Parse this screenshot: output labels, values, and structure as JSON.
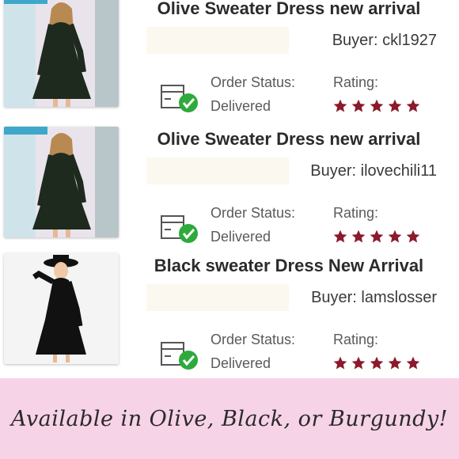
{
  "orders": [
    {
      "title": "Olive Sweater Dress new arrival",
      "buyer": "Buyer: ckl1927",
      "status_label": "Order Status:",
      "status_value": "Delivered",
      "rating_label": "Rating:",
      "rating": 5,
      "dress_color": "#1f2a1f"
    },
    {
      "title": "Olive Sweater Dress new arrival",
      "buyer": "Buyer: ilovechili11",
      "status_label": "Order Status:",
      "status_value": "Delivered",
      "rating_label": "Rating:",
      "rating": 5,
      "dress_color": "#1f2a1f"
    },
    {
      "title": "Black sweater Dress New Arrival",
      "buyer": "Buyer: lamslosser",
      "status_label": "Order Status:",
      "status_value": "Delivered",
      "rating_label": "Rating:",
      "rating": 5,
      "dress_color": "#111111"
    }
  ],
  "banner": {
    "text": "Available in Olive, Black, or Burgundy!",
    "background": "#f7d3e8"
  },
  "colors": {
    "star": "#8b1a2b",
    "check": "#2eaa3c"
  }
}
